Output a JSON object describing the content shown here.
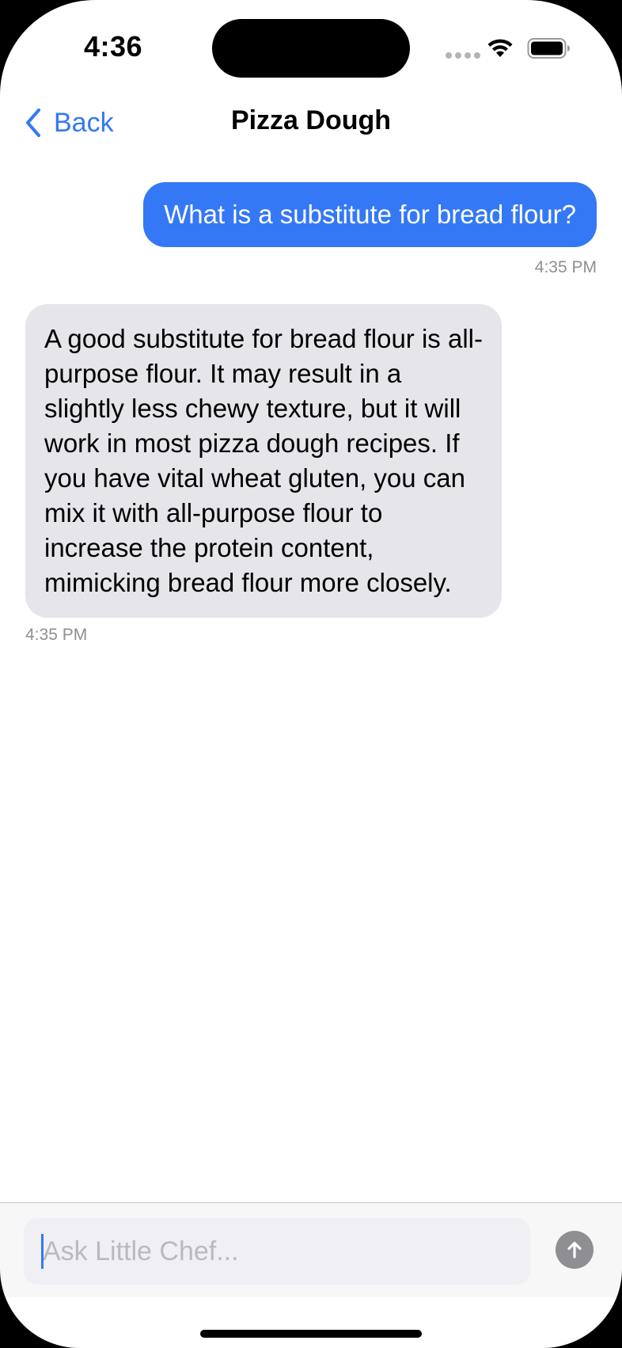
{
  "status_bar": {
    "time": "4:36"
  },
  "nav": {
    "back_label": "Back",
    "title": "Pizza Dough"
  },
  "messages": [
    {
      "role": "user",
      "text": "What is a substitute for bread flour?",
      "time": "4:35 PM"
    },
    {
      "role": "assistant",
      "text": "A good substitute for bread flour is all-purpose flour. It may result in a slightly less chewy texture, but it will work in most pizza dough recipes. If you have vital wheat gluten, you can mix it with all-purpose flour to increase the protein content, mimicking bread flour more closely.",
      "time": "4:35 PM"
    }
  ],
  "composer": {
    "placeholder": "Ask Little Chef...",
    "value": ""
  },
  "icons": {
    "back": "chevron-left-icon",
    "send": "arrow-up-icon",
    "wifi": "wifi-icon",
    "battery": "battery-icon"
  },
  "colors": {
    "accent": "#3478f6",
    "user_bubble": "#3478f6",
    "assistant_bubble": "#e5e5ea",
    "send_button_disabled": "#8e8e93"
  }
}
